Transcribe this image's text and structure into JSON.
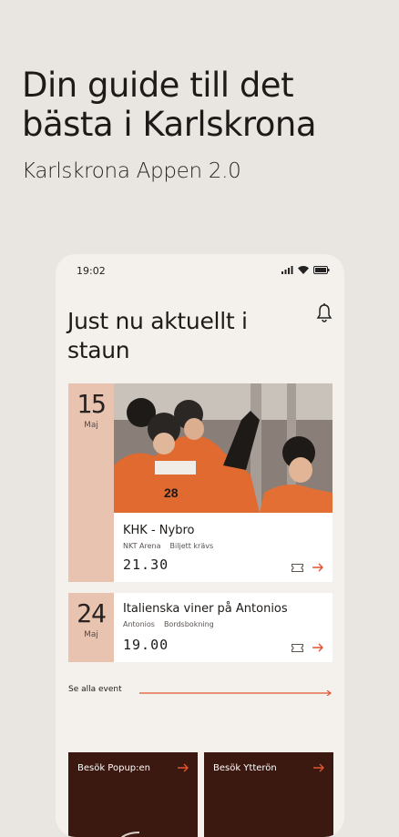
{
  "hero": {
    "title": "Din guide till det bästa i Karlskrona",
    "subtitle": "Karlskrona Appen 2.0"
  },
  "status_bar": {
    "time": "19:02"
  },
  "section": {
    "title": "Just nu aktuellt i staun"
  },
  "events": [
    {
      "day": "15",
      "month": "Maj",
      "name": "KHK - Nybro",
      "venue": "NKT Arena",
      "info": "Biljett krävs",
      "time": "21.30"
    },
    {
      "day": "24",
      "month": "Maj",
      "name": "Italienska viner på Antonios",
      "venue": "Antonios",
      "info": "Bordsbokning",
      "time": "19.00"
    }
  ],
  "see_all": {
    "label": "Se alla event"
  },
  "promos": [
    {
      "label": "Besök Popup:en"
    },
    {
      "label": "Besök Ytterön"
    }
  ],
  "colors": {
    "accent": "#e0552e",
    "date_bg": "#e8c3b0",
    "promo_bg": "#3b1810",
    "page_bg": "#e9e5e1",
    "phone_bg": "#f4f1ec"
  }
}
